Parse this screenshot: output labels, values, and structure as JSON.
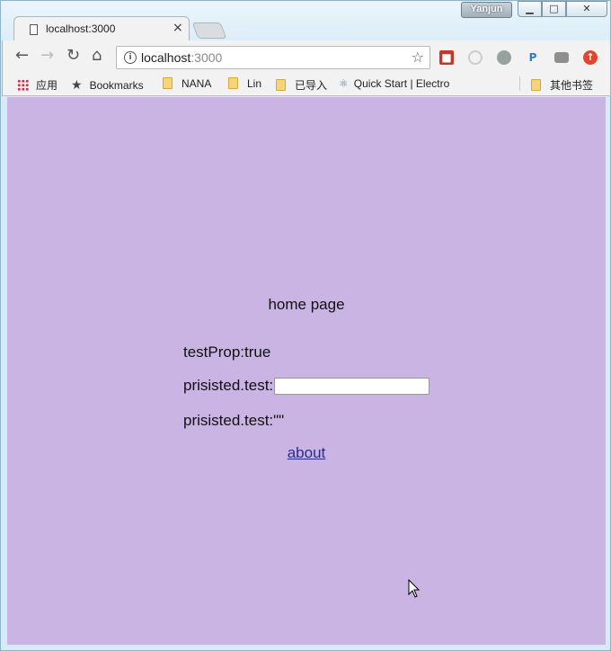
{
  "window": {
    "user_badge": "Yanjun",
    "min_glyph": "▁",
    "max_glyph": "□",
    "close_glyph": "✕"
  },
  "tab": {
    "title": "localhost:3000",
    "close_glyph": "×"
  },
  "toolbar": {
    "back_glyph": "←",
    "forward_glyph": "→",
    "reload_glyph": "↻",
    "home_glyph": "⌂",
    "url_host": "localhost",
    "url_port": ":3000",
    "star_glyph": "☆",
    "extension_icons": [
      "extension-red-icon",
      "extension-gray-circle-icon",
      "extension-dark-circle-icon",
      "extension-p-icon",
      "extension-camera-icon",
      "extension-orange-up-icon"
    ],
    "ext_p_label": "P"
  },
  "bookmarks": {
    "apps_label": "应用",
    "items": [
      "Bookmarks",
      "NANA",
      "Lin",
      "已导入",
      "Quick Start | Electro"
    ],
    "other_label": "其他书签"
  },
  "page": {
    "background": "#c9b4e4",
    "heading": "home page",
    "test_prop": "testProp:true",
    "persisted_input_label": "prisisted.test:",
    "persisted_input_value": "",
    "persisted_value_text": "prisisted.test:\"\"",
    "about_link": "about"
  }
}
